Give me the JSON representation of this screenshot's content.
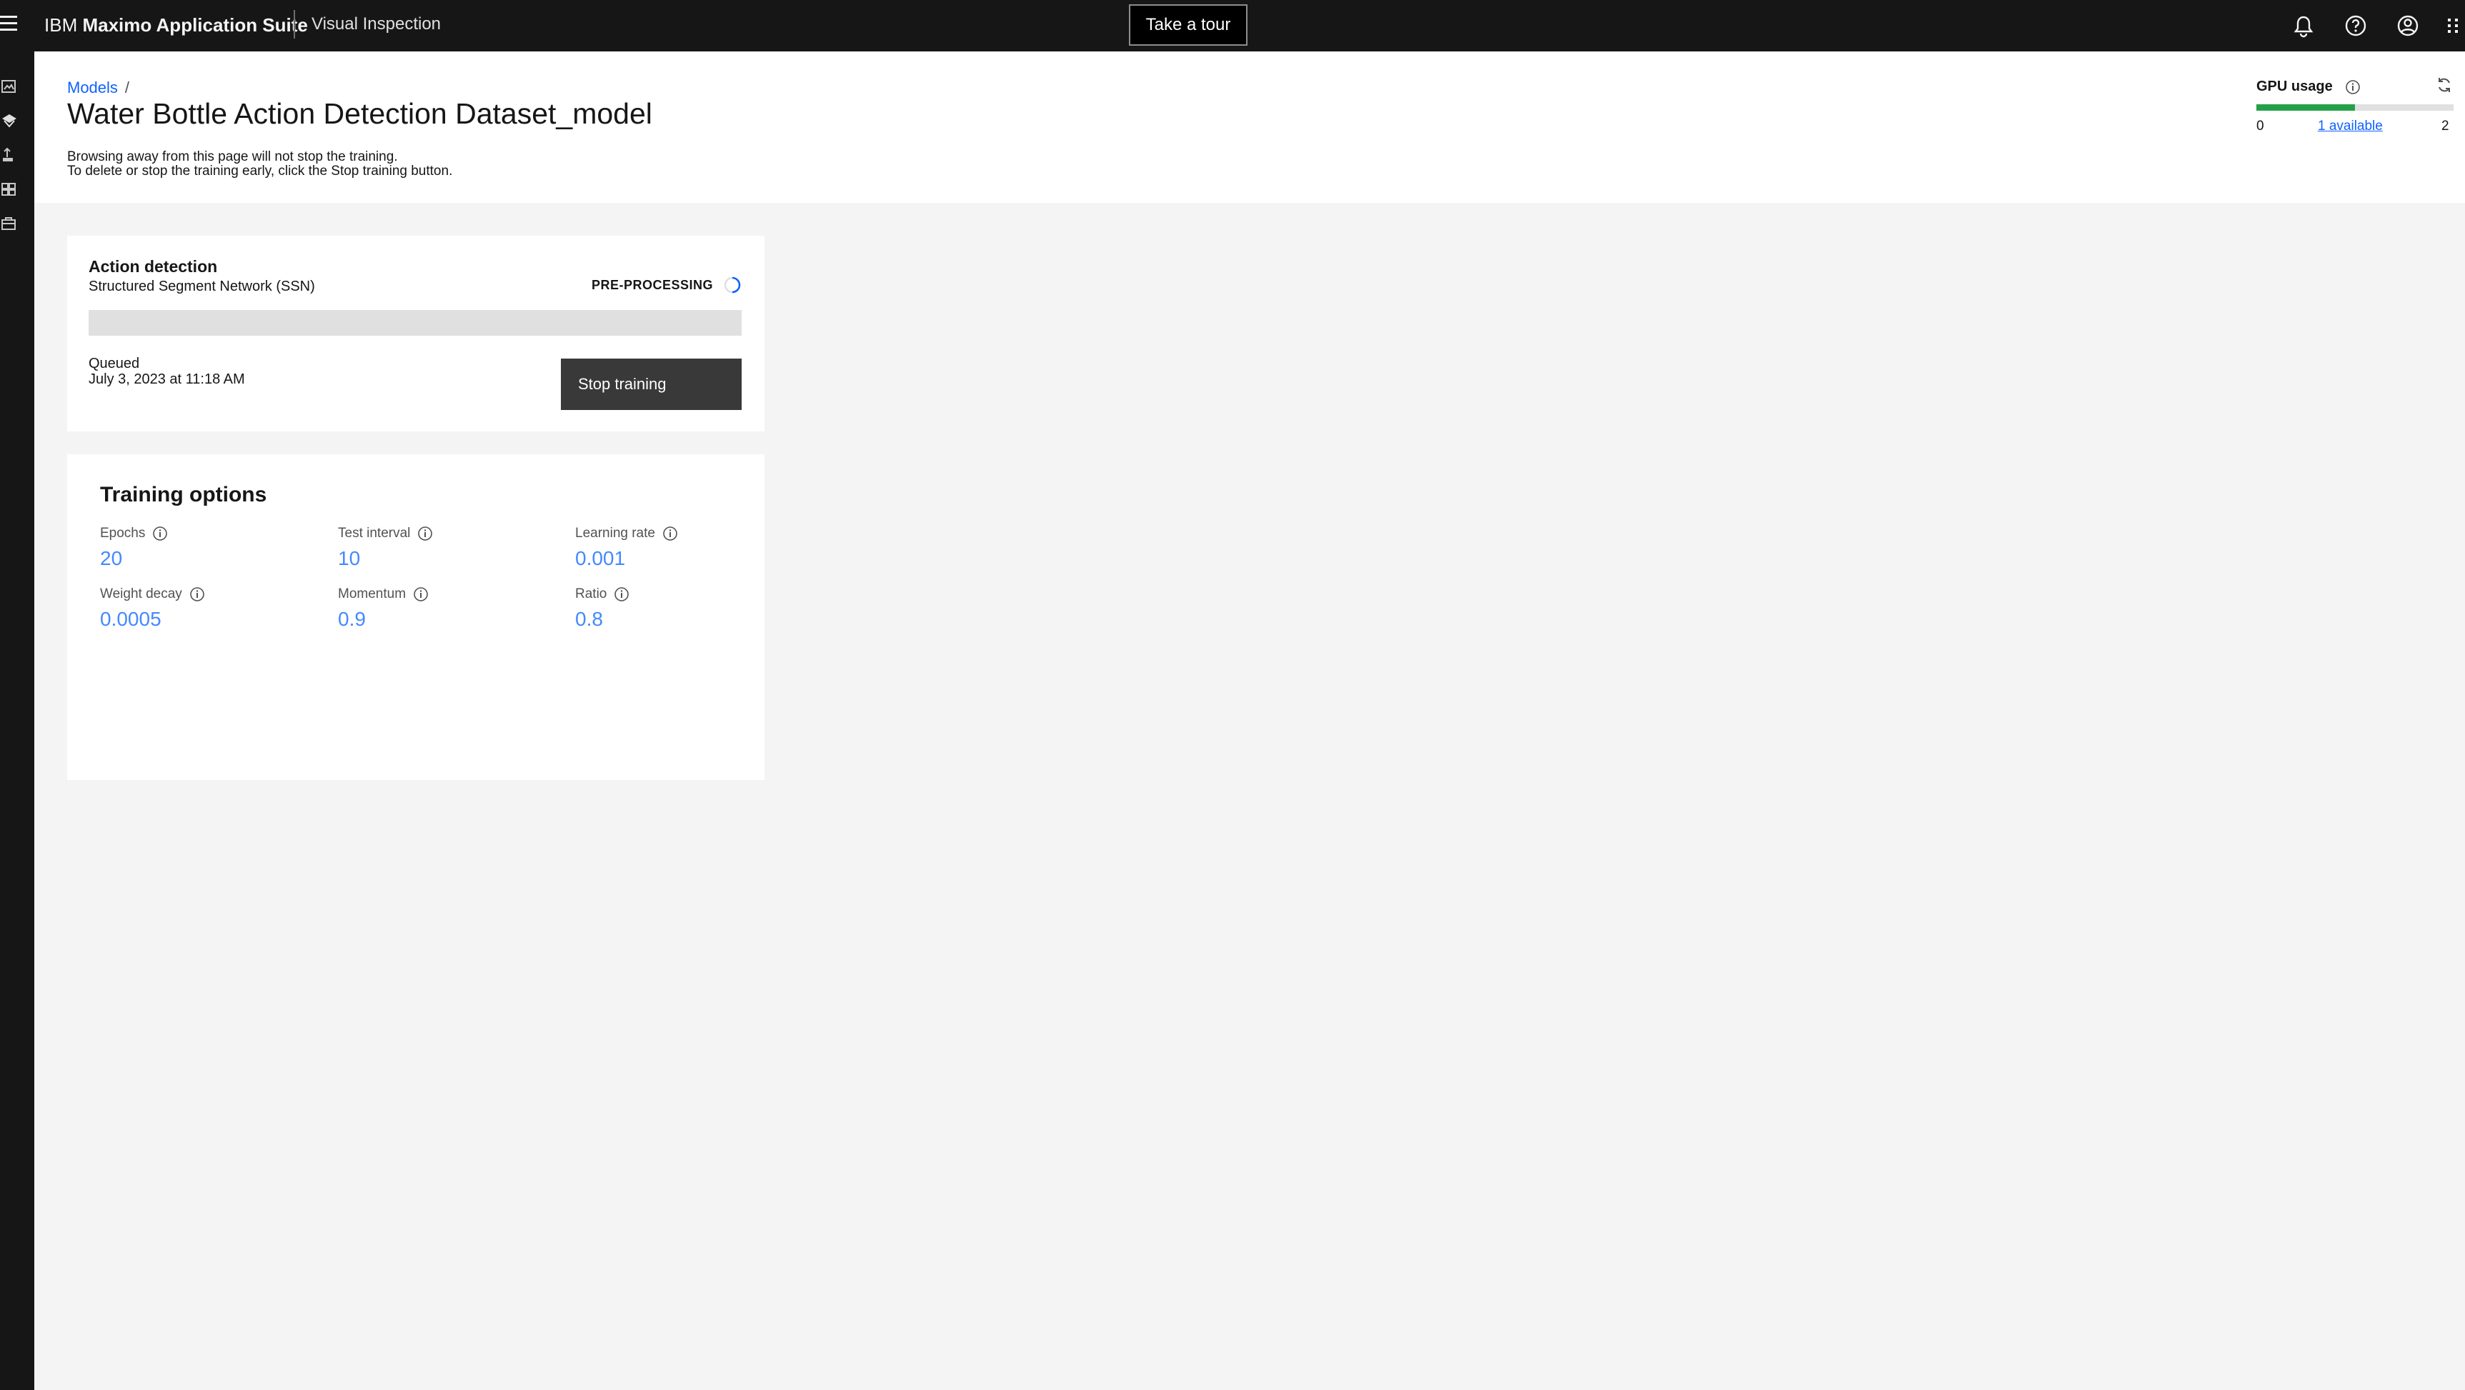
{
  "header": {
    "brand_prefix": "IBM",
    "brand_name": "Maximo Application Suite",
    "product": "Visual Inspection",
    "tour_button": "Take a tour",
    "icons": [
      "notification-icon",
      "help-icon",
      "user-avatar-icon",
      "app-switcher-icon"
    ]
  },
  "sidebar": {
    "items": [
      {
        "icon": "datasets-icon"
      },
      {
        "icon": "models-icon"
      },
      {
        "icon": "deploy-icon"
      },
      {
        "icon": "data-sets-grid-icon"
      },
      {
        "icon": "edge-icon"
      }
    ]
  },
  "breadcrumb": {
    "link": "Models",
    "separator": "/"
  },
  "page": {
    "title": "Water Bottle Action Detection Dataset_model",
    "note_line1": "Browsing away from this page will not stop the training.",
    "note_line2": "To delete or stop the training early, click the Stop training button."
  },
  "gpu": {
    "label": "GPU usage",
    "min": "0",
    "available": "1 available",
    "max": "2",
    "used_fraction": 0.5,
    "color": "#24a148"
  },
  "training": {
    "type": "Action detection",
    "network": "Structured Segment Network (SSN)",
    "status": "PRE-PROCESSING",
    "progress": 0,
    "queued_label": "Queued",
    "queued_date": "July 3, 2023 at 11:18 AM",
    "stop_button": "Stop training"
  },
  "options": {
    "heading": "Training options",
    "items": [
      {
        "label": "Epochs",
        "value": "20"
      },
      {
        "label": "Test interval",
        "value": "10"
      },
      {
        "label": "Learning rate",
        "value": "0.001"
      },
      {
        "label": "Weight decay",
        "value": "0.0005"
      },
      {
        "label": "Momentum",
        "value": "0.9"
      },
      {
        "label": "Ratio",
        "value": "0.8"
      }
    ]
  },
  "colors": {
    "link": "#0f62fe",
    "value": "#4589ff",
    "header_bg": "#161616"
  }
}
